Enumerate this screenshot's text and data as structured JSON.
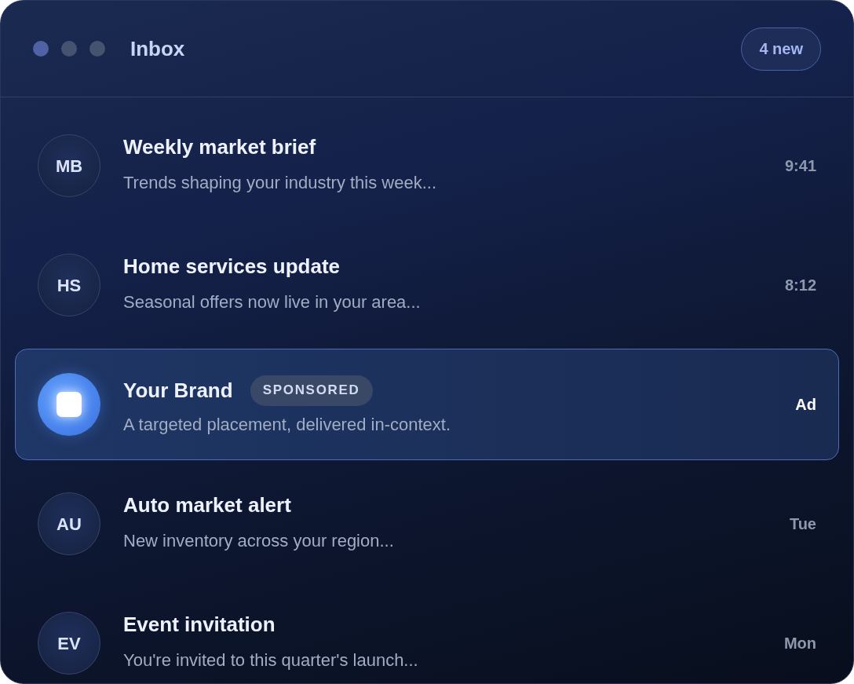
{
  "window": {
    "title": "Inbox",
    "badge": "4 new"
  },
  "messages": [
    {
      "kind": "message",
      "initials": "MB",
      "title": "Weekly market brief",
      "preview": "Trends shaping your industry this week...",
      "time": "9:41"
    },
    {
      "kind": "message",
      "initials": "HS",
      "title": "Home services update",
      "preview": "Seasonal offers now live in your area...",
      "time": "8:12"
    },
    {
      "kind": "ad",
      "title": "Your Brand",
      "tag": "SPONSORED",
      "preview": "A targeted placement, delivered in-context.",
      "time": "Ad"
    },
    {
      "kind": "message",
      "initials": "AU",
      "title": "Auto market alert",
      "preview": "New inventory across your region...",
      "time": "Tue"
    },
    {
      "kind": "message",
      "initials": "EV",
      "title": "Event invitation",
      "preview": "You're invited to this quarter's launch...",
      "time": "Mon"
    }
  ]
}
